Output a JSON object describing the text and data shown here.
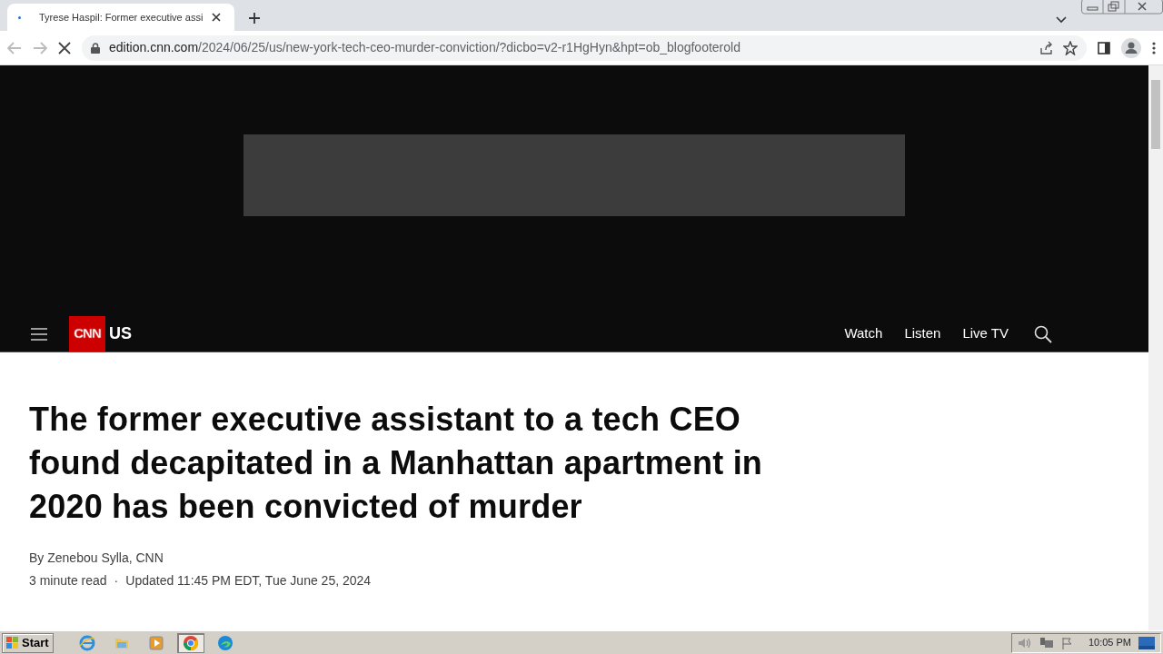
{
  "browser": {
    "tab": {
      "title": "Tyrese Haspil: Former executive assi",
      "selected": true
    },
    "url": {
      "host": "edition.cnn.com",
      "path": "/2024/06/25/us/new-york-tech-ceo-murder-conviction/?dicbo=v2-r1HgHyn&hpt=ob_blogfooterold"
    }
  },
  "site_nav": {
    "logo": "CNN",
    "section": "US",
    "links": [
      "Watch",
      "Listen",
      "Live TV"
    ]
  },
  "article": {
    "headline": "The former executive assistant to a tech CEO found decapitated in a Manhattan apartment in 2020 has been convicted of murder",
    "byline": "By Zenebou Sylla, CNN",
    "read_time": "3 minute read",
    "separator": "·",
    "updated": "Updated 11:45 PM EDT, Tue June 25, 2024"
  },
  "taskbar": {
    "start": "Start",
    "apps": [
      {
        "kind": "ie",
        "selected": false
      },
      {
        "kind": "folder",
        "selected": false
      },
      {
        "kind": "media",
        "selected": false
      },
      {
        "kind": "chrome",
        "selected": true
      },
      {
        "kind": "edge",
        "selected": false
      }
    ],
    "clock": "10:05 PM"
  }
}
